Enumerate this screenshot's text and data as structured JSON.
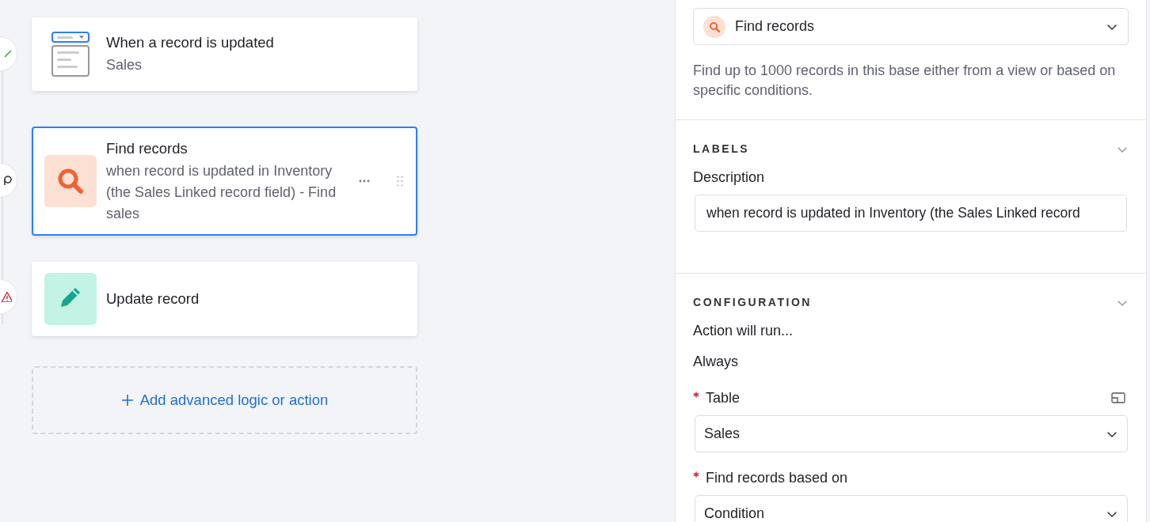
{
  "rail": {
    "markers": [
      {
        "kind": "success"
      },
      {
        "kind": "plain"
      },
      {
        "kind": "warning"
      }
    ]
  },
  "steps": [
    {
      "kind": "trigger",
      "title": "When a record is updated",
      "subtitle": "Sales",
      "selected": false
    },
    {
      "kind": "find",
      "title": "Find records",
      "subtitle": "when record is updated in Inventory (the Sales Linked record field) - Find sales",
      "selected": true
    },
    {
      "kind": "update",
      "title": "Update record",
      "selected": false
    }
  ],
  "add_action": {
    "label": "Add advanced logic or action"
  },
  "panel": {
    "action_select": {
      "value": "Find records"
    },
    "summary": "Find up to 1000 records in this base either from a view or based on specific conditions.",
    "labels_section": {
      "heading": "LABELS",
      "field_label": "Description",
      "field_value": "when record is updated in Inventory (the Sales Linked record"
    },
    "configuration_section": {
      "heading": "CONFIGURATION",
      "run_label": "Action will run...",
      "run_value": "Always",
      "fields": [
        {
          "label": "Table",
          "required": true,
          "value": "Sales",
          "has_side_icon": true
        },
        {
          "label": "Find records based on",
          "required": true,
          "value": "Condition",
          "has_side_icon": false
        }
      ]
    }
  }
}
